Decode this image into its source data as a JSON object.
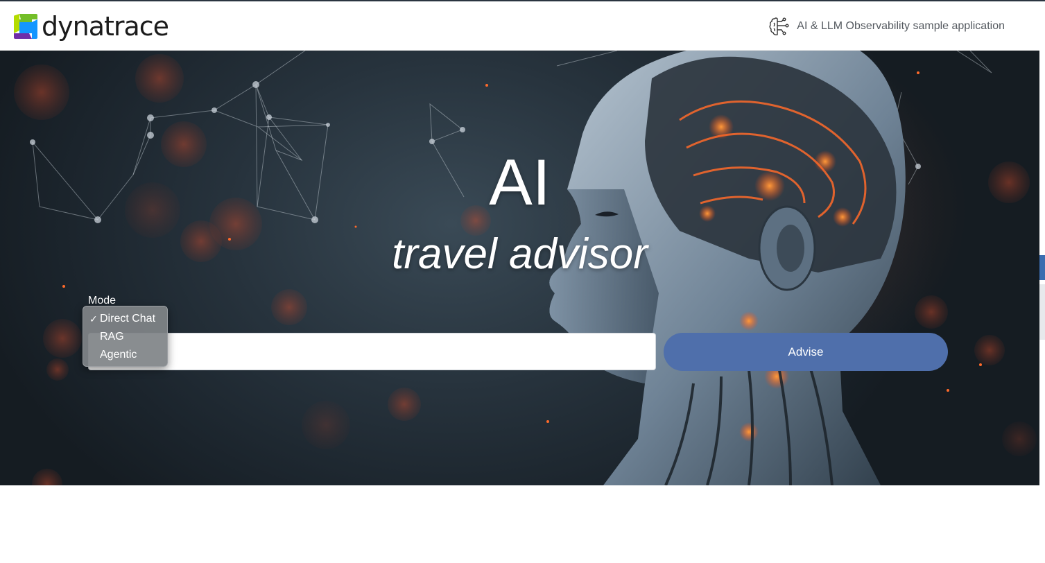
{
  "header": {
    "logo_text": "dynatrace",
    "tagline": "AI & LLM Observability sample application",
    "tagline_icon": "brain-circuit-icon"
  },
  "hero": {
    "title": "AI",
    "subtitle": "travel advisor"
  },
  "form": {
    "mode_label": "Mode",
    "mode_options": [
      {
        "label": "Direct Chat",
        "selected": true
      },
      {
        "label": "RAG",
        "selected": false
      },
      {
        "label": "Agentic",
        "selected": false
      }
    ],
    "check_mark": "✓",
    "input_value": "",
    "submit_label": "Advise"
  },
  "colors": {
    "button": "#4f6fab",
    "hero_dark": "#1b242c",
    "accent_orange": "#ff5a2a"
  }
}
